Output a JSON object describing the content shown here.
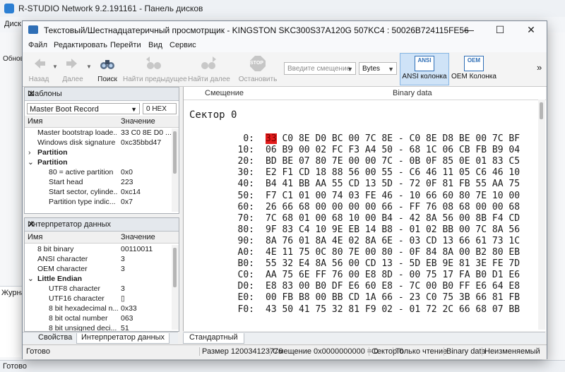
{
  "background_app": {
    "title": "R-STUDIO Network 9.2.191161 - Панель дисков",
    "menu_first": "Диск",
    "status": "Готово",
    "left_label": "Обнов",
    "bottom_label": "Журна"
  },
  "window": {
    "title": "Текстовый/Шестнадцатеричный просмотрщик - KINGSTON SKC300S37A120G 507KC4 : 50026B724115FE56",
    "minimize": "—",
    "maximize": "☐",
    "close": "✕"
  },
  "menu": [
    "Файл",
    "Редактировать",
    "Перейти",
    "Вид",
    "Сервис"
  ],
  "toolbar": {
    "back": "Назад",
    "forward": "Далее",
    "search": "Поиск",
    "find_prev": "Найти предыдущее",
    "find_next": "Найти далее",
    "stop": "Остановить",
    "stop_icon_text": "STOP",
    "offset_placeholder": "Введите смещение",
    "unit": "Bytes",
    "ansi_col": "ANSI колонка",
    "ansi_icon_text": "ANSI",
    "oem_col": "OEM Колонка",
    "oem_icon_text": "OEM",
    "more": "»"
  },
  "templates_panel": {
    "title": "Шаблоны",
    "selected": "Master Boot Record",
    "hex_toggle": "0 HEX",
    "col_name": "Имя",
    "col_value": "Значение",
    "rows": [
      {
        "name": "Master bootstrap loade...",
        "value": "33 C0 8E D0 ..."
      },
      {
        "name": "Windows disk signature",
        "value": "0xc35bbd47"
      },
      {
        "name": "Partition",
        "value": "",
        "exp": "›"
      },
      {
        "name": "Partition",
        "value": "",
        "exp": "⌄"
      },
      {
        "name": "80 = active partition",
        "value": "0x0"
      },
      {
        "name": "Start head",
        "value": "223"
      },
      {
        "name": "Start sector, cylinde...",
        "value": "0xc14"
      },
      {
        "name": "Partition type indic...",
        "value": "0x7"
      }
    ]
  },
  "interpreter_panel": {
    "title": "Интерпретатор данных",
    "col_name": "Имя",
    "col_value": "Значение",
    "rows": [
      {
        "name": "8 bit binary",
        "value": "00110011"
      },
      {
        "name": "ANSI character",
        "value": "3"
      },
      {
        "name": "OEM character",
        "value": "3"
      },
      {
        "name": "Little Endian",
        "value": "",
        "exp": "⌄"
      },
      {
        "name": "UTF8 character",
        "value": "3"
      },
      {
        "name": "UTF16 character",
        "value": "▯"
      },
      {
        "name": "8 bit hexadecimal n...",
        "value": "0x33"
      },
      {
        "name": "8 bit octal number",
        "value": "063"
      },
      {
        "name": "8 bit unsigned deci...",
        "value": "51"
      }
    ]
  },
  "left_tabs": [
    "Свойства",
    "Интерпретатор данных"
  ],
  "hex_view": {
    "col_offset": "Смещение",
    "col_data": "Binary data",
    "sector": "Сектор 0",
    "first_byte": "33",
    "first_row_rest": " C0 8E D0 BC 00 7C 8E - C0 8E D8 BE 00 7C BF",
    "rows": [
      {
        "off": "0:",
        "hex": ""
      },
      {
        "off": "10:",
        "hex": "06 B9 00 02 FC F3 A4 50 - 68 1C 06 CB FB B9 04"
      },
      {
        "off": "20:",
        "hex": "BD BE 07 80 7E 00 00 7C - 0B 0F 85 0E 01 83 C5"
      },
      {
        "off": "30:",
        "hex": "E2 F1 CD 18 88 56 00 55 - C6 46 11 05 C6 46 10"
      },
      {
        "off": "40:",
        "hex": "B4 41 BB AA 55 CD 13 5D - 72 0F 81 FB 55 AA 75"
      },
      {
        "off": "50:",
        "hex": "F7 C1 01 00 74 03 FE 46 - 10 66 60 80 7E 10 00"
      },
      {
        "off": "60:",
        "hex": "26 66 68 00 00 00 00 66 - FF 76 08 68 00 00 68"
      },
      {
        "off": "70:",
        "hex": "7C 68 01 00 68 10 00 B4 - 42 8A 56 00 8B F4 CD"
      },
      {
        "off": "80:",
        "hex": "9F 83 C4 10 9E EB 14 B8 - 01 02 BB 00 7C 8A 56"
      },
      {
        "off": "90:",
        "hex": "8A 76 01 8A 4E 02 8A 6E - 03 CD 13 66 61 73 1C"
      },
      {
        "off": "A0:",
        "hex": "4E 11 75 0C 80 7E 00 80 - 0F 84 8A 00 B2 80 EB"
      },
      {
        "off": "B0:",
        "hex": "55 32 E4 8A 56 00 CD 13 - 5D EB 9E 81 3E FE 7D"
      },
      {
        "off": "C0:",
        "hex": "AA 75 6E FF 76 00 E8 8D - 00 75 17 FA B0 D1 E6"
      },
      {
        "off": "D0:",
        "hex": "E8 83 00 B0 DF E6 60 E8 - 7C 00 B0 FF E6 64 E8"
      },
      {
        "off": "E0:",
        "hex": "00 FB B8 00 BB CD 1A 66 - 23 C0 75 3B 66 81 FB"
      },
      {
        "off": "F0:",
        "hex": "43 50 41 75 32 81 F9 02 - 01 72 2C 66 68 07 BB"
      }
    ],
    "tab": "Стандартный"
  },
  "status": {
    "ready": "Готово",
    "size": "Размер 120034123776",
    "offset": "Смещение 0x0000000000 = 0",
    "sector": "Сектор 0",
    "mode": "Только чтение",
    "type": "Binary data",
    "state": "Неизменяемый"
  },
  "colors": {
    "highlight": "#e21b1b",
    "accent": "#2f6fb6"
  }
}
